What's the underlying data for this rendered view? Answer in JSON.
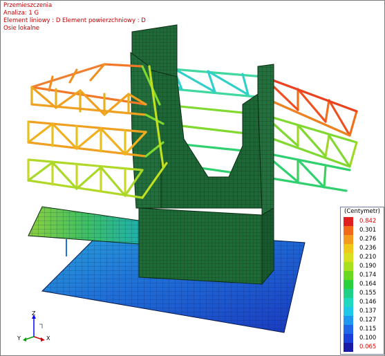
{
  "info": {
    "line1": "Przemieszczenia",
    "line2": "Analiza: 1  G",
    "line3": "Element liniowy : D Element powierzchniowy : D",
    "line4": "Osie lokalne"
  },
  "legend": {
    "title": "(Centymetr)",
    "items": [
      {
        "value": "0.842",
        "color": "#e02020",
        "highlight": true
      },
      {
        "value": "0.301",
        "color": "#f06a1a"
      },
      {
        "value": "0.276",
        "color": "#f59a20"
      },
      {
        "value": "0.236",
        "color": "#f0c81c"
      },
      {
        "value": "0.210",
        "color": "#d8e020"
      },
      {
        "value": "0.190",
        "color": "#a8e020"
      },
      {
        "value": "0.174",
        "color": "#6ad820"
      },
      {
        "value": "0.164",
        "color": "#28d040"
      },
      {
        "value": "0.155",
        "color": "#20d088"
      },
      {
        "value": "0.146",
        "color": "#20d8c0"
      },
      {
        "value": "0.137",
        "color": "#20c8e8"
      },
      {
        "value": "0.127",
        "color": "#2098f0"
      },
      {
        "value": "0.115",
        "color": "#2068e8"
      },
      {
        "value": "0.100",
        "color": "#1a40d8"
      },
      {
        "value": "0.065",
        "color": "#1a1aa8",
        "highlight": true
      }
    ]
  },
  "axes": {
    "z": "Z",
    "y": "Y",
    "x": "X"
  }
}
